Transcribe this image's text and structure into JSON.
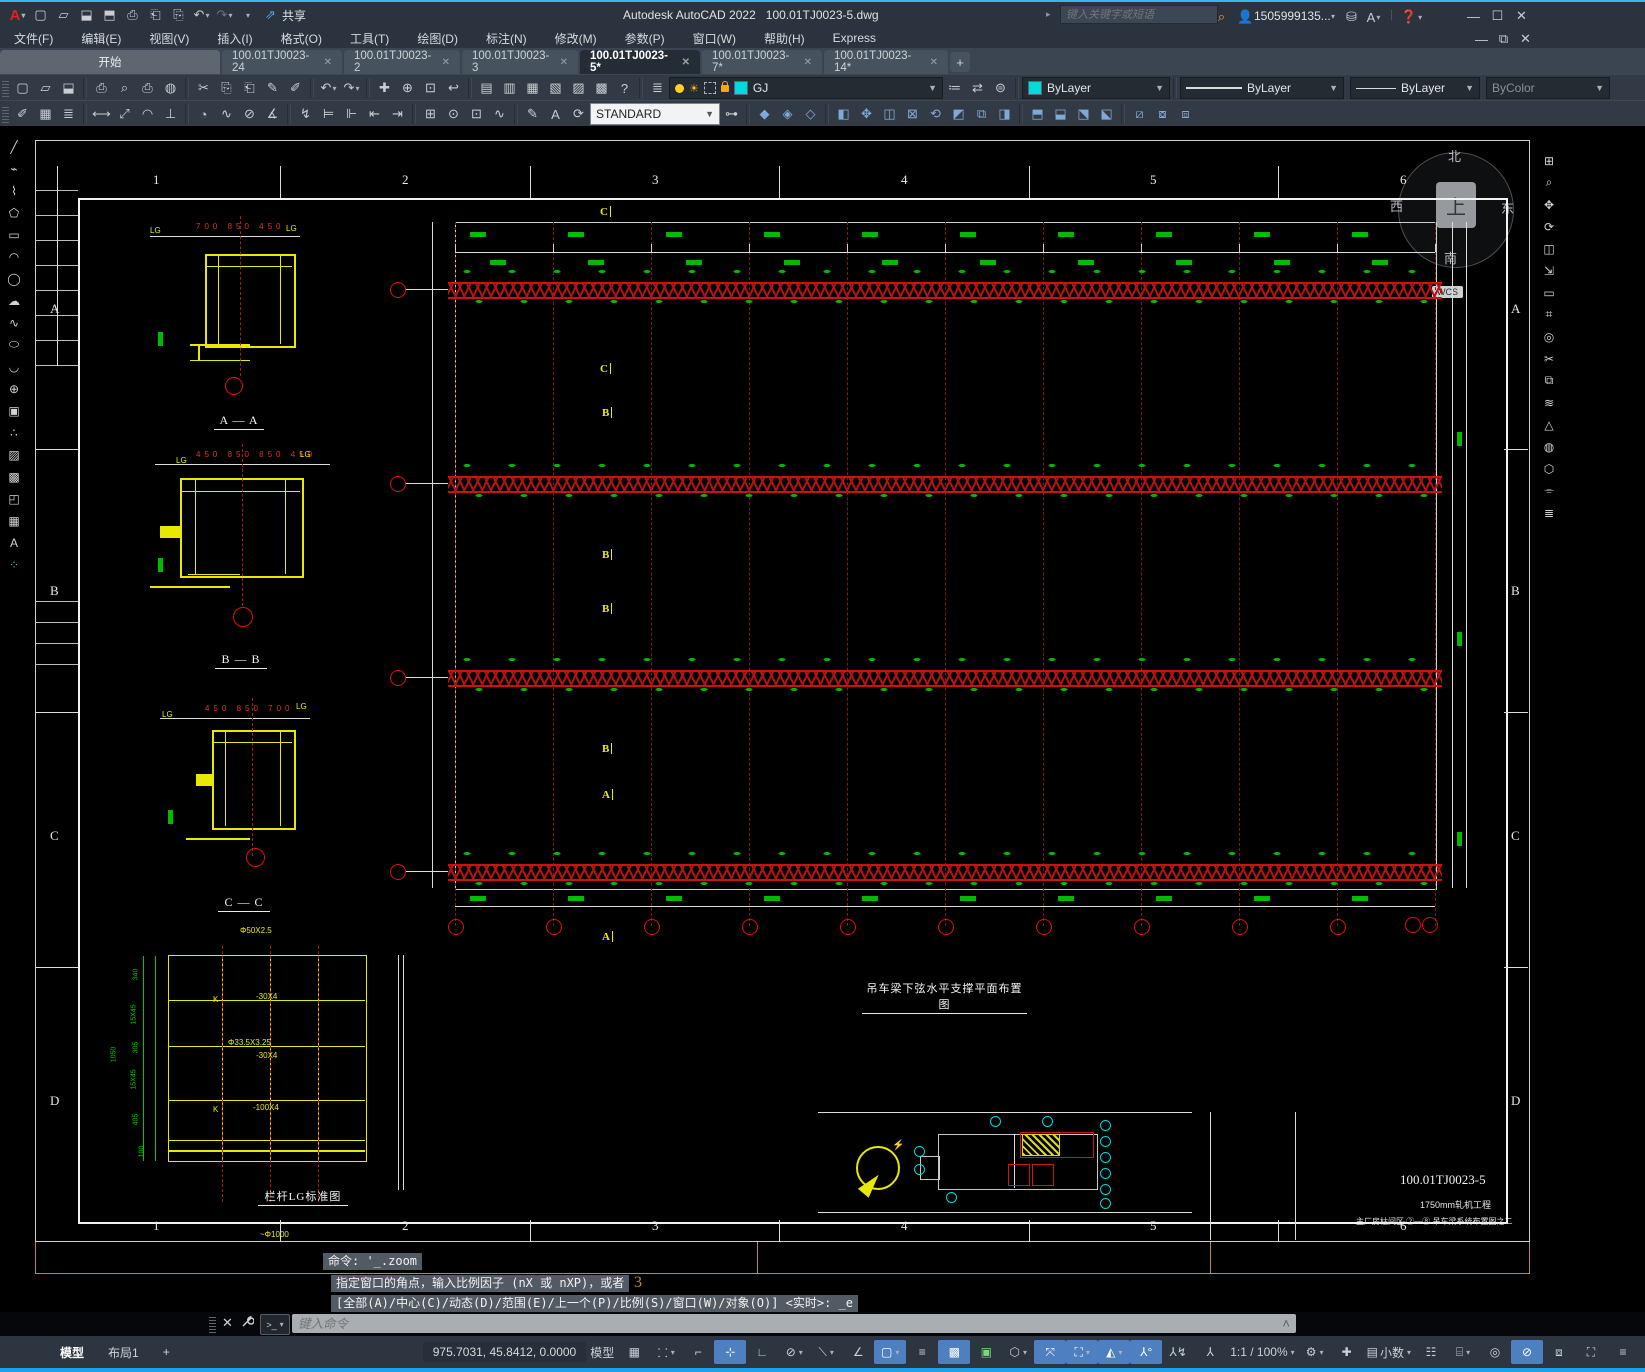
{
  "window": {
    "app_title": "Autodesk AutoCAD 2022",
    "doc_title": "100.01TJ0023-5.dwg",
    "share_label": "共享",
    "search_placeholder": "键入关键字或短语",
    "user_id": "1505999135...",
    "help_label": "?"
  },
  "menus": [
    "文件(F)",
    "编辑(E)",
    "视图(V)",
    "插入(I)",
    "格式(O)",
    "工具(T)",
    "绘图(D)",
    "标注(N)",
    "修改(M)",
    "参数(P)",
    "窗口(W)",
    "帮助(H)",
    "Express"
  ],
  "tabs": {
    "start": "开始",
    "items": [
      {
        "label": "100.01TJ0023-24",
        "active": false
      },
      {
        "label": "100.01TJ0023-2",
        "active": false
      },
      {
        "label": "100.01TJ0023-3",
        "active": false
      },
      {
        "label": "100.01TJ0023-5*",
        "active": true
      },
      {
        "label": "100.01TJ0023-7*",
        "active": false
      },
      {
        "label": "100.01TJ0023-14*",
        "active": false
      }
    ]
  },
  "toolbars": {
    "layer_current": "GJ",
    "color": "ByLayer",
    "linetype": "ByLayer",
    "lineweight": "ByLayer",
    "plotstyle": "ByColor",
    "dimstyle": "STANDARD"
  },
  "drawing": {
    "grid_cols": [
      "1",
      "2",
      "3",
      "4",
      "5",
      "6"
    ],
    "grid_rows": [
      "A",
      "B",
      "C",
      "D"
    ],
    "plan_title": "吊车梁下弦水平支撑平面布置图",
    "plan_marks": [
      "C",
      "C",
      "B",
      "B",
      "B",
      "B",
      "A",
      "A"
    ],
    "sections": {
      "a": {
        "title": "A — A",
        "dims": "700 850 450",
        "lg": "LG"
      },
      "b": {
        "title": "B — B",
        "dims": "450 850 850 450",
        "lg": "LG"
      },
      "c": {
        "title": "C — C",
        "dims": "450 850 700",
        "lg": "LG"
      }
    },
    "railing": {
      "title": "栏杆LG标准图",
      "label_top_pipe": "Φ50X2.5",
      "label_flat1": "-30X4",
      "label_mid_pipe": "Φ33.5X3.25",
      "label_flat2": "-30X4",
      "label_flat3": "-100X4",
      "label_k": "K",
      "label_dia": "~Φ1000",
      "dim_340": "340",
      "dim_15x45": "15X45",
      "dim_305": "305",
      "dim_405": "405",
      "dim_1050": "1050",
      "dim_100": "100"
    },
    "titleblock": {
      "number": "100.01TJ0023-5",
      "project": "1750mm轧机工程",
      "sheet_name": "主厂房柱间区 ②—⑧ 吊车梁系统布置图之二"
    },
    "compass": {
      "n": "北",
      "s": "南",
      "w": "西",
      "e": "东",
      "up": "上"
    },
    "wcs": "WCS",
    "margin_num": "3"
  },
  "commandline": {
    "history1": "命令: '_.zoom",
    "history2": "指定窗口的角点，输入比例因子 (nX 或 nXP)，或者",
    "history3": "[全部(A)/中心(C)/动态(D)/范围(E)/上一个(P)/比例(S)/窗口(W)/对象(O)] <实时>: _e",
    "prompt": ">_",
    "input_placeholder": "键入命令"
  },
  "statusbar": {
    "model_tab": "模型",
    "layout_tab": "布局1",
    "new_layout": "+",
    "coordinates": "975.7031, 45.8412, 0.0000",
    "model_button": "模型",
    "scale": "1:1 / 100%",
    "units": "小数"
  }
}
